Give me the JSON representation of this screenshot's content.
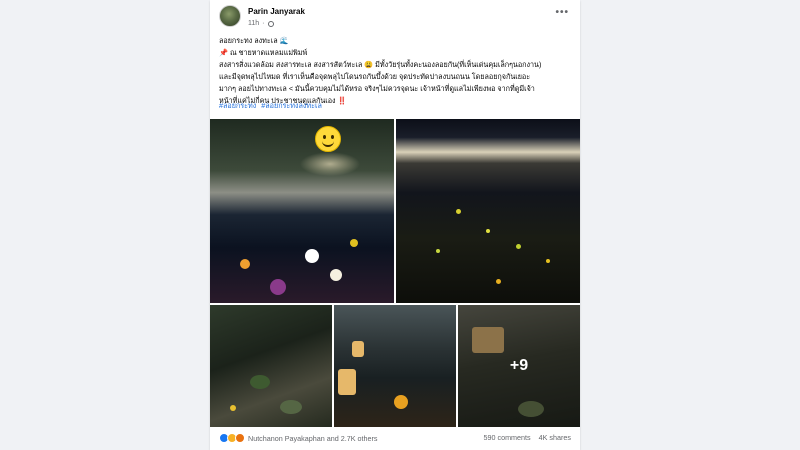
{
  "post": {
    "author": "Parin Janyarak",
    "time": "11h",
    "text_lines": [
      "ลอยกระทง ลงทะเล 🌊",
      "📌 ณ ชายหาดแหลมแม่พิมพ์",
      "สงสารสิ่งแวดล้อม สงสารทะเล สงสารสัตว์ทะเล 😩 มีทั้งวัยรุ่นทั้งคะนองลอยกัน(ที่เห็นเด่นคุมเล็กๆนอกงาน)",
      "และมีจุดพลุไปไหมด ที่เราเห็นคือจุดพลุไปโดนรถกันบึ้งด้วย จุดประทัดปาลงบนถนน โดยลอยกุจกันเยอะ",
      "มากๆ ลอยไปทางทะเล < มันนี้ควบคุมไม่ได้หรอ จริงๆไม่ควรจุดนะ เจ้าหน้าที่ดูแลไม่เพียงพอ จากที่ดูมีเจ้า",
      "หน้าที่แค่ไม่กี่คน ประชาชนดูแลกันเอง ‼️"
    ],
    "hashtags": [
      "#ลอยกระทง",
      "#ลอยกระทงลงทะเล"
    ],
    "more_photos": "+9"
  },
  "footer": {
    "reactions_text": "Nutchanon Payakaphan and 2.7K others",
    "comments": "590 comments",
    "shares": "4K shares"
  },
  "icons": {
    "more": "more-options-icon",
    "privacy": "globe-icon",
    "reactions": [
      "like-icon",
      "haha-icon",
      "angry-icon"
    ]
  }
}
